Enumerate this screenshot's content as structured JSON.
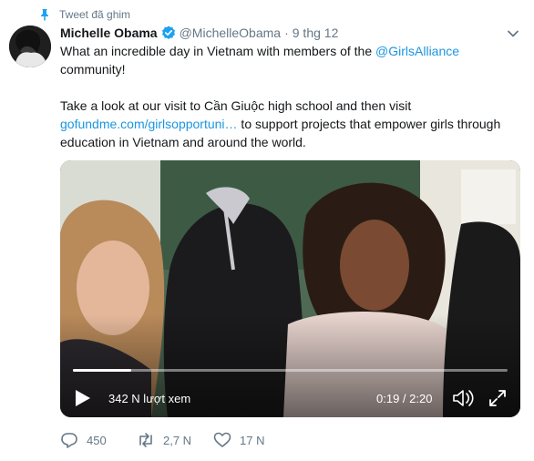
{
  "pinned": {
    "label": "Tweet đã ghim"
  },
  "tweet": {
    "display_name": "Michelle Obama",
    "handle": "@MichelleObama",
    "separator": "·",
    "time": "9 thg 12",
    "text": {
      "line1_prefix": "What an incredible day in Vietnam with members of the ",
      "line1_mention": "@GirlsAlliance",
      "line1_suffix": "community!",
      "line2": "Take a look at our visit to Cần Giuộc high school and then visit",
      "line3_link": "gofundme.com/girlsopportuni…",
      "line3_suffix": " to support projects that empower girls through",
      "line4": "education in Vietnam and around the world."
    }
  },
  "video": {
    "views": "342 N lượt xem",
    "timecode": "0:19 / 2:20",
    "progress": 0.135
  },
  "actions": {
    "replies": "450",
    "retweets": "2,7 N",
    "likes": "17 N"
  },
  "colors": {
    "link": "#1b95e0",
    "verified": "#1da1f2",
    "muted": "#657786"
  }
}
